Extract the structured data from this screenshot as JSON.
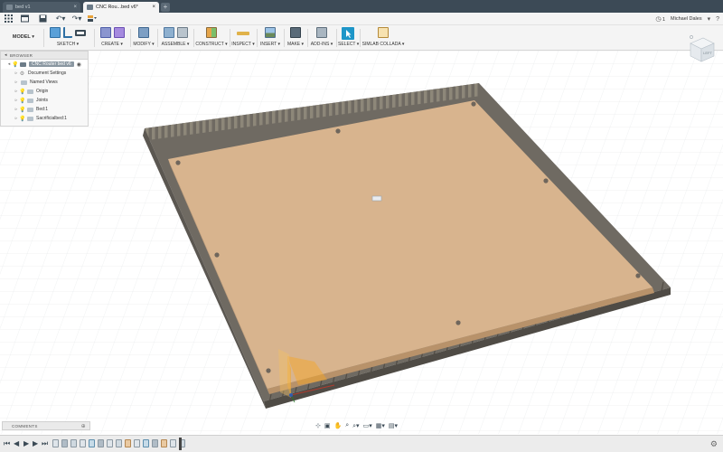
{
  "tabs": [
    {
      "label": "bed v1",
      "active": false
    },
    {
      "label": "CNC Rou...bed v6*",
      "active": true
    }
  ],
  "quick_access": {
    "grid_icon": "app-grid-icon",
    "file_icon": "file-icon",
    "save_icon": "save-icon",
    "undo_icon": "undo-icon",
    "redo_icon": "redo-icon",
    "job_icon": "job-status-icon"
  },
  "header": {
    "clock_count": "1",
    "user_name": "Michael Dales",
    "help_icon": "help-icon",
    "notification_icon": "bell-icon"
  },
  "ribbon": {
    "workspace": "MODEL",
    "groups": [
      {
        "id": "sketch",
        "label": "SKETCH ▾"
      },
      {
        "id": "create",
        "label": "CREATE ▾"
      },
      {
        "id": "modify",
        "label": "MODIFY ▾"
      },
      {
        "id": "assemble",
        "label": "ASSEMBLE ▾"
      },
      {
        "id": "construct",
        "label": "CONSTRUCT ▾"
      },
      {
        "id": "inspect",
        "label": "INSPECT ▾"
      },
      {
        "id": "insert",
        "label": "INSERT ▾"
      },
      {
        "id": "make",
        "label": "MAKE ▾"
      },
      {
        "id": "addins",
        "label": "ADD-INS ▾"
      },
      {
        "id": "select",
        "label": "SELECT ▾"
      },
      {
        "id": "simlab",
        "label": "SIMLAB COLLADA ▾"
      }
    ]
  },
  "browser": {
    "title": "BROWSER",
    "items": [
      {
        "label": "CNC Router bed v6",
        "root": true
      },
      {
        "label": "Document Settings"
      },
      {
        "label": "Named Views"
      },
      {
        "label": "Origin"
      },
      {
        "label": "Joints"
      },
      {
        "label": "Bed:1"
      },
      {
        "label": "Sacrificialbed:1"
      }
    ]
  },
  "viewcube": {
    "face_label": "LEFT"
  },
  "comments": {
    "label": "COMMENTS"
  },
  "colors": {
    "tab_bar": "#3c4a56",
    "toolbar_bg": "#f4f4f4",
    "mdf_top": "#d8b48e",
    "mdf_edge": "#b8926a",
    "bed_metal": "#6f6a62",
    "bed_metal_light": "#8d8779",
    "select_accent": "#1e96c8",
    "origin_orange": "#f5a623"
  }
}
